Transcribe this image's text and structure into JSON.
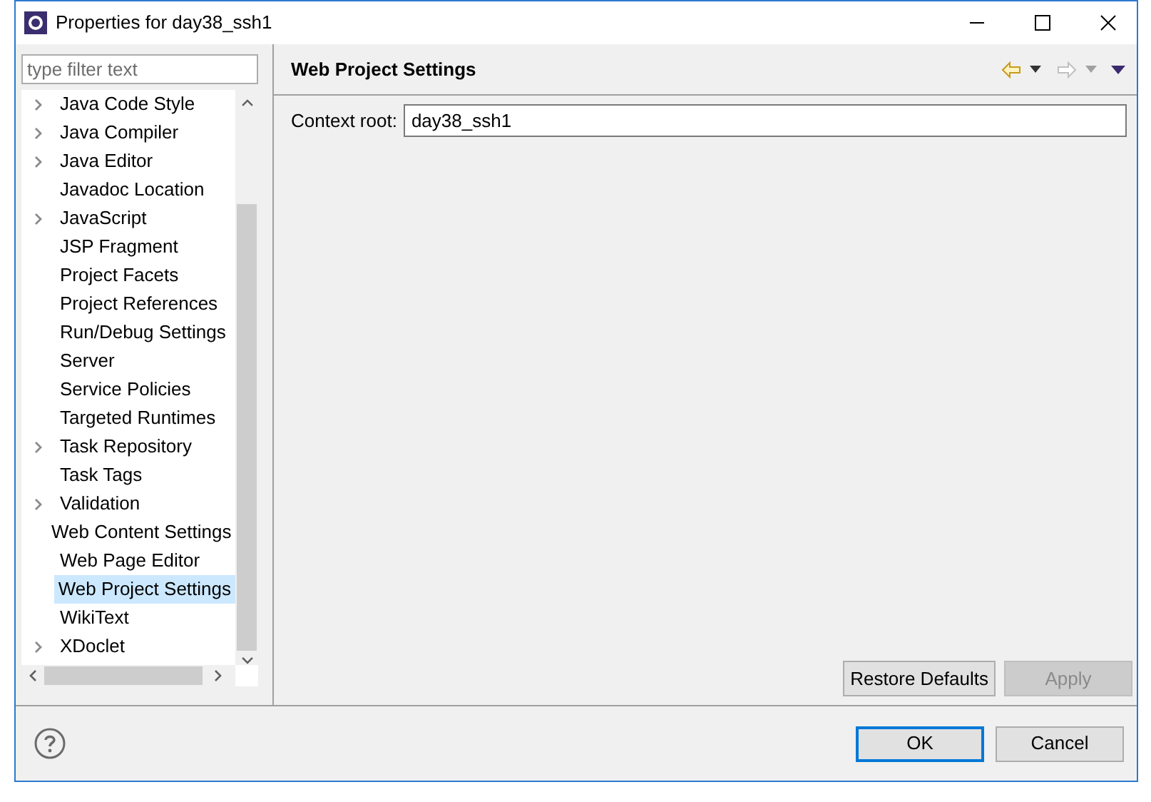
{
  "window": {
    "title": "Properties for day38_ssh1"
  },
  "filter": {
    "placeholder": "type filter text"
  },
  "tree": {
    "items": [
      {
        "label": "Java Code Style",
        "expandable": true,
        "selected": false
      },
      {
        "label": "Java Compiler",
        "expandable": true,
        "selected": false
      },
      {
        "label": "Java Editor",
        "expandable": true,
        "selected": false
      },
      {
        "label": "Javadoc Location",
        "expandable": false,
        "selected": false
      },
      {
        "label": "JavaScript",
        "expandable": true,
        "selected": false
      },
      {
        "label": "JSP Fragment",
        "expandable": false,
        "selected": false
      },
      {
        "label": "Project Facets",
        "expandable": false,
        "selected": false
      },
      {
        "label": "Project References",
        "expandable": false,
        "selected": false
      },
      {
        "label": "Run/Debug Settings",
        "expandable": false,
        "selected": false
      },
      {
        "label": "Server",
        "expandable": false,
        "selected": false
      },
      {
        "label": "Service Policies",
        "expandable": false,
        "selected": false
      },
      {
        "label": "Targeted Runtimes",
        "expandable": false,
        "selected": false
      },
      {
        "label": "Task Repository",
        "expandable": true,
        "selected": false
      },
      {
        "label": "Task Tags",
        "expandable": false,
        "selected": false
      },
      {
        "label": "Validation",
        "expandable": true,
        "selected": false
      },
      {
        "label": "Web Content Settings",
        "expandable": false,
        "selected": false
      },
      {
        "label": "Web Page Editor",
        "expandable": false,
        "selected": false
      },
      {
        "label": "Web Project Settings",
        "expandable": false,
        "selected": true
      },
      {
        "label": "WikiText",
        "expandable": false,
        "selected": false
      },
      {
        "label": "XDoclet",
        "expandable": true,
        "selected": false
      }
    ]
  },
  "page": {
    "title": "Web Project Settings",
    "context_root": {
      "label": "Context root:",
      "value": "day38_ssh1"
    }
  },
  "page_buttons": [
    {
      "label": "Restore Defaults",
      "disabled": false
    },
    {
      "label": "Apply",
      "disabled": true
    }
  ],
  "dialog_buttons": [
    {
      "label": "OK",
      "default": true
    },
    {
      "label": "Cancel",
      "default": false
    }
  ]
}
